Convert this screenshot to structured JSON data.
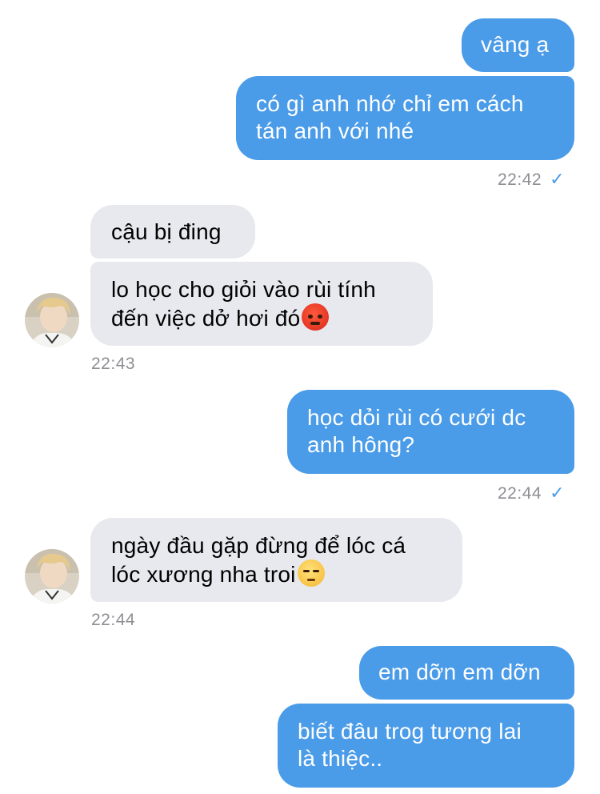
{
  "messages": [
    {
      "direction": "outgoing",
      "lines": [
        "vâng ạ"
      ]
    },
    {
      "direction": "outgoing",
      "lines": [
        "có gì anh nhớ chỉ em cách",
        "tán anh với nhé"
      ]
    },
    {
      "direction": "incoming",
      "lines": [
        "cậu bị đing"
      ]
    },
    {
      "direction": "incoming",
      "lines": [
        "lo học cho giỏi vào rùi tính",
        "đến việc dở hơi đó"
      ],
      "emoji": "angry-face-emoji"
    },
    {
      "direction": "outgoing",
      "lines": [
        "học dỏi rùi có cưới dc",
        "anh hông?"
      ]
    },
    {
      "direction": "incoming",
      "lines": [
        "ngày đầu gặp đừng để lóc cá",
        "lóc xương nha troi"
      ],
      "emoji": "unamused-face-emoji"
    },
    {
      "direction": "outgoing",
      "lines": [
        "em dỡn em dỡn"
      ]
    },
    {
      "direction": "outgoing",
      "lines": [
        "biết đâu trog tương lai",
        "là thiệc.."
      ]
    }
  ],
  "timestamps": [
    "22:42",
    "22:43",
    "22:44",
    "22:44"
  ],
  "read_check": "✓",
  "colors": {
    "outgoing_bubble": "#4a9be8",
    "incoming_bubble": "#e8e9ee",
    "timestamp": "#8e8e93"
  }
}
